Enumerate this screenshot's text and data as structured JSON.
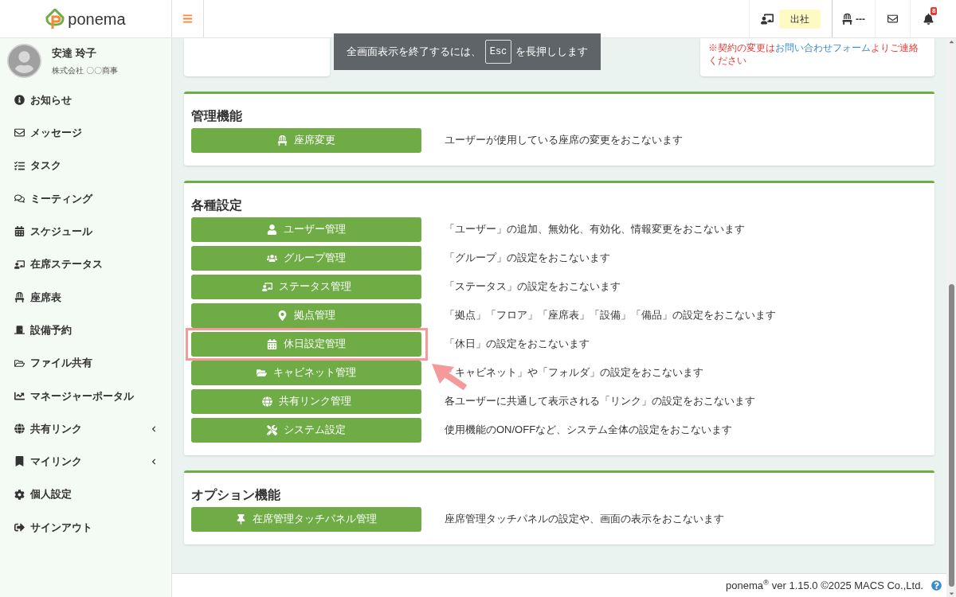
{
  "header": {
    "logo": "ponema",
    "status_badge": "出社",
    "seat": "---",
    "notification_count": "8"
  },
  "user": {
    "name": "安達 玲子",
    "company": "株式会社 〇〇商事"
  },
  "sidebar": {
    "items": [
      {
        "label": "お知らせ",
        "has_submenu": false
      },
      {
        "label": "メッセージ",
        "has_submenu": false
      },
      {
        "label": "タスク",
        "has_submenu": false
      },
      {
        "label": "ミーティング",
        "has_submenu": false
      },
      {
        "label": "スケジュール",
        "has_submenu": false
      },
      {
        "label": "在席ステータス",
        "has_submenu": false
      },
      {
        "label": "座席表",
        "has_submenu": false
      },
      {
        "label": "設備予約",
        "has_submenu": false
      },
      {
        "label": "ファイル共有",
        "has_submenu": false
      },
      {
        "label": "マネージャーポータル",
        "has_submenu": false
      },
      {
        "label": "共有リンク",
        "has_submenu": true
      },
      {
        "label": "マイリンク",
        "has_submenu": true
      },
      {
        "label": "個人設定",
        "has_submenu": false
      },
      {
        "label": "サインアウト",
        "has_submenu": false
      }
    ]
  },
  "fullscreen_toast": {
    "before": "全画面表示を終了するには、",
    "key": "Esc",
    "after": "を長押しします"
  },
  "contract_notice": {
    "before": "※契約の変更は",
    "link": "お問い合わせフォーム",
    "after": "よりご連絡ください"
  },
  "sections": [
    {
      "title": "管理機能",
      "rows": [
        {
          "button": "座席変更",
          "description": "ユーザーが使用している座席の変更をおこないます",
          "highlighted": false
        }
      ]
    },
    {
      "title": "各種設定",
      "rows": [
        {
          "button": "ユーザー管理",
          "description": "「ユーザー」の追加、無効化、有効化、情報変更をおこないます",
          "highlighted": false
        },
        {
          "button": "グループ管理",
          "description": "「グループ」の設定をおこないます",
          "highlighted": false
        },
        {
          "button": "ステータス管理",
          "description": "「ステータス」の設定をおこないます",
          "highlighted": false
        },
        {
          "button": "拠点管理",
          "description": "「拠点」「フロア」「座席表」「設備」「備品」の設定をおこないます",
          "highlighted": false
        },
        {
          "button": "休日設定管理",
          "description": "「休日」の設定をおこないます",
          "highlighted": true
        },
        {
          "button": "キャビネット管理",
          "description": "「キャビネット」や「フォルダ」の設定をおこないます",
          "highlighted": false
        },
        {
          "button": "共有リンク管理",
          "description": "各ユーザーに共通して表示される「リンク」の設定をおこないます",
          "highlighted": false
        },
        {
          "button": "システム設定",
          "description": "使用機能のON/OFFなど、システム全体の設定をおこないます",
          "highlighted": false
        }
      ]
    },
    {
      "title": "オプション機能",
      "rows": [
        {
          "button": "在席管理タッチパネル管理",
          "description": "座席管理タッチパネルの設定や、画面の表示をおこないます",
          "highlighted": false
        }
      ]
    }
  ],
  "footer": {
    "text": "ponema$^{®}$ ver 1.15.0 ©2025 MACS Co.,Ltd."
  }
}
